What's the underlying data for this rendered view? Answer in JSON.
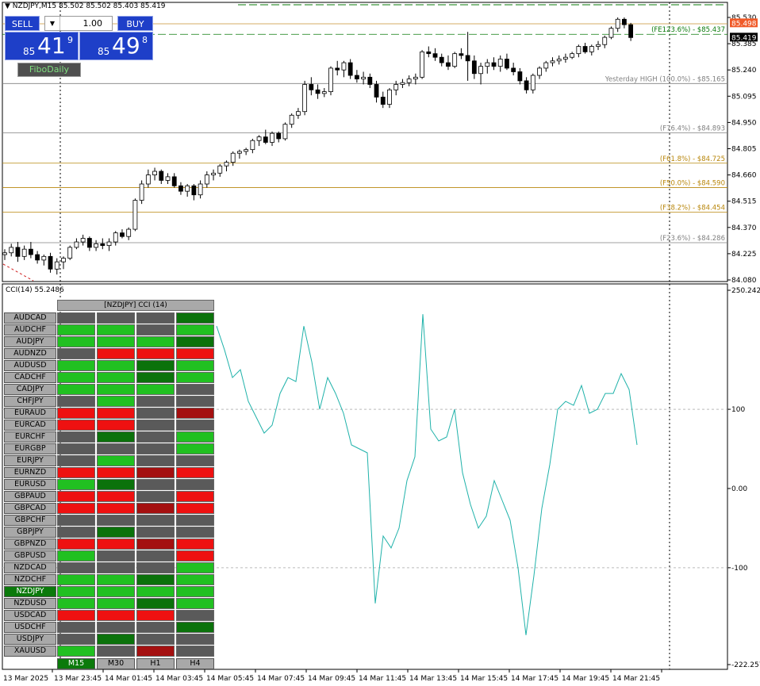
{
  "header": {
    "symbol_info": "NZDJPY,M15",
    "ohlc": "85.502 85.502 85.403 85.419"
  },
  "trade_panel": {
    "sell_label": "SELL",
    "buy_label": "BUY",
    "lot": "1.00",
    "lot_arrow": "▼",
    "sell_price": {
      "prefix": "85",
      "big": "41",
      "sup": "9"
    },
    "buy_price": {
      "prefix": "85",
      "big": "49",
      "sup": "8"
    }
  },
  "fibo_button": "FiboDaily",
  "price_axis": {
    "min": 84.08,
    "max": 85.53,
    "ticks": [
      {
        "v": 85.53,
        "l": "85.530"
      },
      {
        "v": 85.385,
        "l": "85.385"
      },
      {
        "v": 85.24,
        "l": "85.240"
      },
      {
        "v": 85.095,
        "l": "85.095"
      },
      {
        "v": 84.95,
        "l": "84.950"
      },
      {
        "v": 84.805,
        "l": "84.805"
      },
      {
        "v": 84.66,
        "l": "84.660"
      },
      {
        "v": 84.515,
        "l": "84.515"
      },
      {
        "v": 84.37,
        "l": "84.370"
      },
      {
        "v": 84.225,
        "l": "84.225"
      },
      {
        "v": 84.08,
        "l": "84.080"
      }
    ],
    "current_ask": "85.498",
    "current_bid": "85.419",
    "ask_color": "#f05a28",
    "bid_color": "#000000"
  },
  "fib_levels": [
    {
      "label": "(FE123.6%) - $85.437",
      "price": 85.437,
      "color": "#0a7a0a",
      "dashed": true
    },
    {
      "label": "Yesterday HIGH (100.0%) - $85.165",
      "price": 85.165,
      "color": "#808080",
      "dashed": false
    },
    {
      "label": "(F76.4%) - $84.893",
      "price": 84.893,
      "color": "#808080",
      "dashed": false
    },
    {
      "label": "(F61.8%) - $84.725",
      "price": 84.725,
      "color": "#b8860b",
      "dashed": false
    },
    {
      "label": "(F50.0%) - $84.590",
      "price": 84.59,
      "color": "#b8860b",
      "dashed": false
    },
    {
      "label": "(F38.2%) - $84.454",
      "price": 84.454,
      "color": "#b8860b",
      "dashed": false
    },
    {
      "label": "(F23.6%) - $84.286",
      "price": 84.286,
      "color": "#808080",
      "dashed": false
    }
  ],
  "cci_panel": {
    "label": "CCI(14) 55.2486",
    "max": 250.2427,
    "min": -222.2579,
    "ticks": [
      {
        "v": 250.2427,
        "l": "250.2427"
      },
      {
        "v": 100,
        "l": "100"
      },
      {
        "v": 0,
        "l": "0.00"
      },
      {
        "v": -100,
        "l": "-100"
      },
      {
        "v": -222.2579,
        "l": "-222.2579"
      }
    ],
    "line_color": "#20b2aa"
  },
  "time_axis": {
    "labels": [
      "13 Mar 2025",
      "13 Mar 23:45",
      "14 Mar 01:45",
      "14 Mar 03:45",
      "14 Mar 05:45",
      "14 Mar 07:45",
      "14 Mar 09:45",
      "14 Mar 11:45",
      "14 Mar 13:45",
      "14 Mar 15:45",
      "14 Mar 17:45",
      "14 Mar 19:45",
      "14 Mar 21:45"
    ]
  },
  "grid": {
    "title": "[NZDJPY]  CCI (14)",
    "colors": {
      "G": "#21c021",
      "D": "#0b720b",
      "R": "#ee1111",
      "M": "#a41010",
      "N": "#5a5a5a"
    },
    "rows": [
      {
        "sym": "AUDCAD",
        "c": "NNND"
      },
      {
        "sym": "AUDCHF",
        "c": "GGNG"
      },
      {
        "sym": "AUDJPY",
        "c": "GGGD"
      },
      {
        "sym": "AUDNZD",
        "c": "NRRR"
      },
      {
        "sym": "AUDUSD",
        "c": "GGDG"
      },
      {
        "sym": "CADCHF",
        "c": "GGDG"
      },
      {
        "sym": "CADJPY",
        "c": "GGGN"
      },
      {
        "sym": "CHFJPY",
        "c": "NGNN"
      },
      {
        "sym": "EURAUD",
        "c": "RRNM"
      },
      {
        "sym": "EURCAD",
        "c": "RRNN"
      },
      {
        "sym": "EURCHF",
        "c": "NDNG"
      },
      {
        "sym": "EURGBP",
        "c": "NNNG"
      },
      {
        "sym": "EURJPY",
        "c": "NGNN"
      },
      {
        "sym": "EURNZD",
        "c": "RRMR"
      },
      {
        "sym": "EURUSD",
        "c": "GDNN"
      },
      {
        "sym": "GBPAUD",
        "c": "RRNR"
      },
      {
        "sym": "GBPCAD",
        "c": "RRMR"
      },
      {
        "sym": "GBPCHF",
        "c": "NNNN"
      },
      {
        "sym": "GBPJPY",
        "c": "NDNN"
      },
      {
        "sym": "GBPNZD",
        "c": "RRMR"
      },
      {
        "sym": "GBPUSD",
        "c": "GNNR"
      },
      {
        "sym": "NZDCAD",
        "c": "NNNG"
      },
      {
        "sym": "NZDCHF",
        "c": "GGDG"
      },
      {
        "sym": "NZDJPY",
        "c": "GGGG",
        "selected": true
      },
      {
        "sym": "NZDUSD",
        "c": "GGDG"
      },
      {
        "sym": "USDCAD",
        "c": "RRRN"
      },
      {
        "sym": "USDCHF",
        "c": "NNND"
      },
      {
        "sym": "USDJPY",
        "c": "NDNN"
      },
      {
        "sym": "XAUUSD",
        "c": "GNMN"
      }
    ],
    "timeframes": [
      "M15",
      "M30",
      "H1",
      "H4"
    ],
    "selected_timeframe": "M15"
  },
  "chart_data": [
    {
      "type": "candlestick",
      "title": "NZDJPY,M15",
      "ylim": [
        84.08,
        85.53
      ],
      "candles": [
        [
          84.22,
          84.25,
          84.19,
          84.23
        ],
        [
          84.23,
          84.28,
          84.21,
          84.26
        ],
        [
          84.26,
          84.29,
          84.18,
          84.21
        ],
        [
          84.21,
          84.27,
          84.19,
          84.25
        ],
        [
          84.25,
          84.29,
          84.2,
          84.22
        ],
        [
          84.22,
          84.24,
          84.17,
          84.19
        ],
        [
          84.19,
          84.22,
          84.16,
          84.21
        ],
        [
          84.21,
          84.23,
          84.12,
          84.14
        ],
        [
          84.14,
          84.2,
          84.11,
          84.18
        ],
        [
          84.18,
          84.21,
          84.14,
          84.2
        ],
        [
          84.2,
          84.27,
          84.19,
          84.26
        ],
        [
          84.26,
          84.31,
          84.25,
          84.29
        ],
        [
          84.29,
          84.33,
          84.27,
          84.31
        ],
        [
          84.31,
          84.32,
          84.24,
          84.26
        ],
        [
          84.26,
          84.3,
          84.24,
          84.28
        ],
        [
          84.28,
          84.31,
          84.25,
          84.27
        ],
        [
          84.27,
          84.31,
          84.24,
          84.29
        ],
        [
          84.29,
          84.35,
          84.27,
          84.34
        ],
        [
          84.34,
          84.36,
          84.31,
          84.32
        ],
        [
          84.32,
          84.37,
          84.3,
          84.36
        ],
        [
          84.36,
          84.53,
          84.35,
          84.52
        ],
        [
          84.52,
          84.63,
          84.5,
          84.61
        ],
        [
          84.61,
          84.69,
          84.59,
          84.66
        ],
        [
          84.66,
          84.7,
          84.63,
          84.68
        ],
        [
          84.68,
          84.69,
          84.61,
          84.63
        ],
        [
          84.63,
          84.67,
          84.61,
          84.65
        ],
        [
          84.65,
          84.67,
          84.59,
          84.6
        ],
        [
          84.6,
          84.62,
          84.55,
          84.57
        ],
        [
          84.57,
          84.61,
          84.54,
          84.6
        ],
        [
          84.6,
          84.61,
          84.52,
          84.55
        ],
        [
          84.55,
          84.63,
          84.53,
          84.61
        ],
        [
          84.61,
          84.68,
          84.59,
          84.66
        ],
        [
          84.66,
          84.69,
          84.63,
          84.67
        ],
        [
          84.67,
          84.72,
          84.65,
          84.71
        ],
        [
          84.71,
          84.74,
          84.68,
          84.73
        ],
        [
          84.73,
          84.79,
          84.71,
          84.78
        ],
        [
          84.78,
          84.8,
          84.75,
          84.79
        ],
        [
          84.79,
          84.81,
          84.77,
          84.8
        ],
        [
          84.8,
          84.86,
          84.78,
          84.85
        ],
        [
          84.85,
          84.88,
          84.82,
          84.87
        ],
        [
          84.87,
          84.91,
          84.83,
          84.84
        ],
        [
          84.84,
          84.9,
          84.82,
          84.89
        ],
        [
          84.89,
          84.9,
          84.84,
          84.86
        ],
        [
          84.86,
          84.95,
          84.85,
          84.94
        ],
        [
          84.94,
          85.0,
          84.92,
          84.99
        ],
        [
          84.99,
          85.03,
          84.97,
          85.01
        ],
        [
          85.01,
          85.18,
          84.99,
          85.16
        ],
        [
          85.16,
          85.2,
          85.1,
          85.13
        ],
        [
          85.13,
          85.16,
          85.08,
          85.11
        ],
        [
          85.11,
          85.14,
          85.09,
          85.12
        ],
        [
          85.12,
          85.26,
          85.1,
          85.25
        ],
        [
          85.25,
          85.29,
          85.21,
          85.24
        ],
        [
          85.24,
          85.29,
          85.2,
          85.28
        ],
        [
          85.28,
          85.3,
          85.19,
          85.21
        ],
        [
          85.21,
          85.24,
          85.17,
          85.19
        ],
        [
          85.19,
          85.23,
          85.16,
          85.2
        ],
        [
          85.2,
          85.22,
          85.14,
          85.16
        ],
        [
          85.16,
          85.18,
          85.06,
          85.09
        ],
        [
          85.09,
          85.12,
          85.03,
          85.05
        ],
        [
          85.05,
          85.14,
          85.03,
          85.13
        ],
        [
          85.13,
          85.18,
          85.1,
          85.16
        ],
        [
          85.16,
          85.19,
          85.14,
          85.17
        ],
        [
          85.17,
          85.21,
          85.15,
          85.19
        ],
        [
          85.19,
          85.22,
          85.16,
          85.2
        ],
        [
          85.2,
          85.35,
          85.19,
          85.34
        ],
        [
          85.34,
          85.37,
          85.31,
          85.33
        ],
        [
          85.33,
          85.36,
          85.29,
          85.31
        ],
        [
          85.31,
          85.33,
          85.26,
          85.28
        ],
        [
          85.28,
          85.32,
          85.24,
          85.26
        ],
        [
          85.26,
          85.34,
          85.25,
          85.33
        ],
        [
          85.33,
          85.36,
          85.3,
          85.32
        ],
        [
          85.32,
          85.45,
          85.18,
          85.29
        ],
        [
          85.29,
          85.32,
          85.19,
          85.22
        ],
        [
          85.22,
          85.28,
          85.16,
          85.26
        ],
        [
          85.26,
          85.3,
          85.22,
          85.28
        ],
        [
          85.28,
          85.31,
          85.24,
          85.26
        ],
        [
          85.26,
          85.32,
          85.23,
          85.3
        ],
        [
          85.3,
          85.33,
          85.24,
          85.25
        ],
        [
          85.25,
          85.28,
          85.21,
          85.23
        ],
        [
          85.23,
          85.25,
          85.16,
          85.18
        ],
        [
          85.18,
          85.2,
          85.11,
          85.13
        ],
        [
          85.13,
          85.22,
          85.11,
          85.21
        ],
        [
          85.21,
          85.26,
          85.19,
          85.25
        ],
        [
          85.25,
          85.29,
          85.23,
          85.28
        ],
        [
          85.28,
          85.31,
          85.26,
          85.29
        ],
        [
          85.29,
          85.32,
          85.27,
          85.3
        ],
        [
          85.3,
          85.33,
          85.28,
          85.31
        ],
        [
          85.31,
          85.34,
          85.3,
          85.33
        ],
        [
          85.33,
          85.38,
          85.31,
          85.37
        ],
        [
          85.37,
          85.39,
          85.33,
          85.34
        ],
        [
          85.34,
          85.38,
          85.32,
          85.37
        ],
        [
          85.37,
          85.4,
          85.35,
          85.38
        ],
        [
          85.38,
          85.43,
          85.36,
          85.42
        ],
        [
          85.42,
          85.48,
          85.41,
          85.47
        ],
        [
          85.47,
          85.53,
          85.45,
          85.52
        ],
        [
          85.52,
          85.53,
          85.47,
          85.49
        ],
        [
          85.49,
          85.5,
          85.4,
          85.419
        ]
      ]
    },
    {
      "type": "line",
      "title": "CCI(14) 55.2486",
      "ylim": [
        -222.2579,
        250.2427
      ],
      "values": [
        205,
        175,
        140,
        150,
        110,
        90,
        70,
        80,
        120,
        140,
        135,
        205,
        160,
        100,
        140,
        120,
        95,
        55,
        50,
        45,
        -145,
        -60,
        -75,
        -50,
        10,
        40,
        220,
        75,
        60,
        65,
        100,
        20,
        -20,
        -50,
        -35,
        10,
        -15,
        -40,
        -100,
        -185,
        -110,
        -25,
        30,
        100,
        110,
        105,
        130,
        95,
        100,
        120,
        120,
        145,
        125,
        55
      ]
    }
  ]
}
